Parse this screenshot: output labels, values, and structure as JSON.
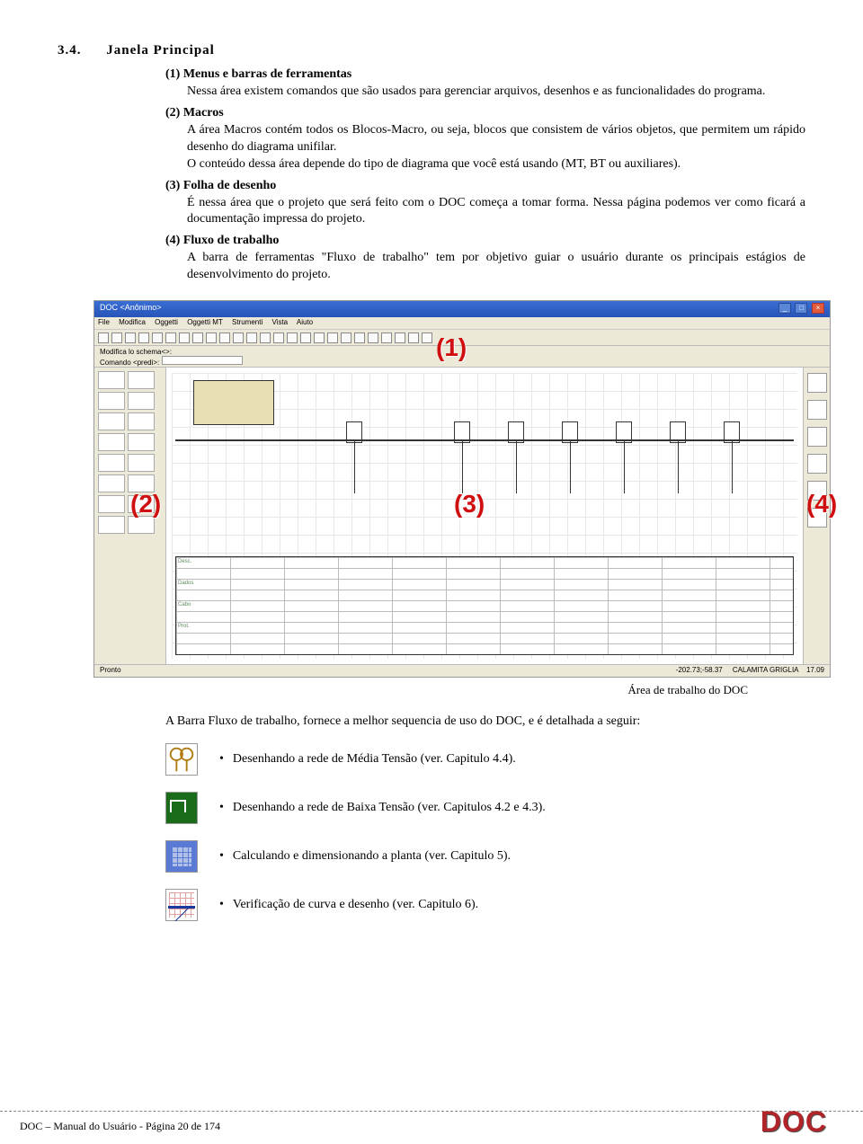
{
  "section": {
    "number": "3.4.",
    "title": "Janela Principal"
  },
  "items": [
    {
      "label": "(1) Menus e barras de ferramentas",
      "body": "Nessa área existem comandos que são usados para gerenciar arquivos, desenhos e as funcionalidades do programa."
    },
    {
      "label": "(2) Macros",
      "body": "A área Macros contém todos os Blocos-Macro, ou seja, blocos que consistem de vários objetos, que permitem um rápido desenho do diagrama unifilar.\nO conteúdo dessa área depende do tipo de diagrama que você está usando (MT, BT ou auxiliares)."
    },
    {
      "label": "(3) Folha de desenho",
      "body": "É nessa área que o projeto que será feito com o DOC começa a tomar forma. Nessa página podemos ver como ficará a documentação impressa do projeto."
    },
    {
      "label": "(4) Fluxo de trabalho",
      "body": "A barra de ferramentas \"Fluxo de trabalho\" tem por objetivo guiar o usuário durante os principais estágios de desenvolvimento do projeto."
    }
  ],
  "app": {
    "title": "DOC <Anônimo>",
    "menus": [
      "File",
      "Modifica",
      "Oggetti",
      "Oggetti MT",
      "Strumenti",
      "Vista",
      "Aiuto"
    ],
    "cmd_label": "Modifica lo schema<>:",
    "cmd_prompt": "Comando <predi>:",
    "status_left": "Pronto",
    "status_mid": "-202.73;-58.37",
    "status_right1": "CALAMITA GRIGLIA",
    "status_right2": "17.09"
  },
  "annotations": {
    "a1": "(1)",
    "a2": "(2)",
    "a3": "(3)",
    "a4": "(4)"
  },
  "caption": "Área de trabalho do DOC",
  "bottom_para": "A Barra Fluxo de trabalho, fornece a melhor sequencia de uso do DOC, e é detalhada a seguir:",
  "bullets": [
    "Desenhando a rede de Média Tensão (ver. Capitulo 4.4).",
    "Desenhando a rede de Baixa Tensão (ver. Capitulos 4.2 e 4.3).",
    "Calculando e dimensionando a planta (ver. Capitulo 5).",
    "Verificação de curva e desenho (ver. Capitulo 6)."
  ],
  "footer": "DOC – Manual do Usuário - Página 20 de 174",
  "logo": "DOC"
}
